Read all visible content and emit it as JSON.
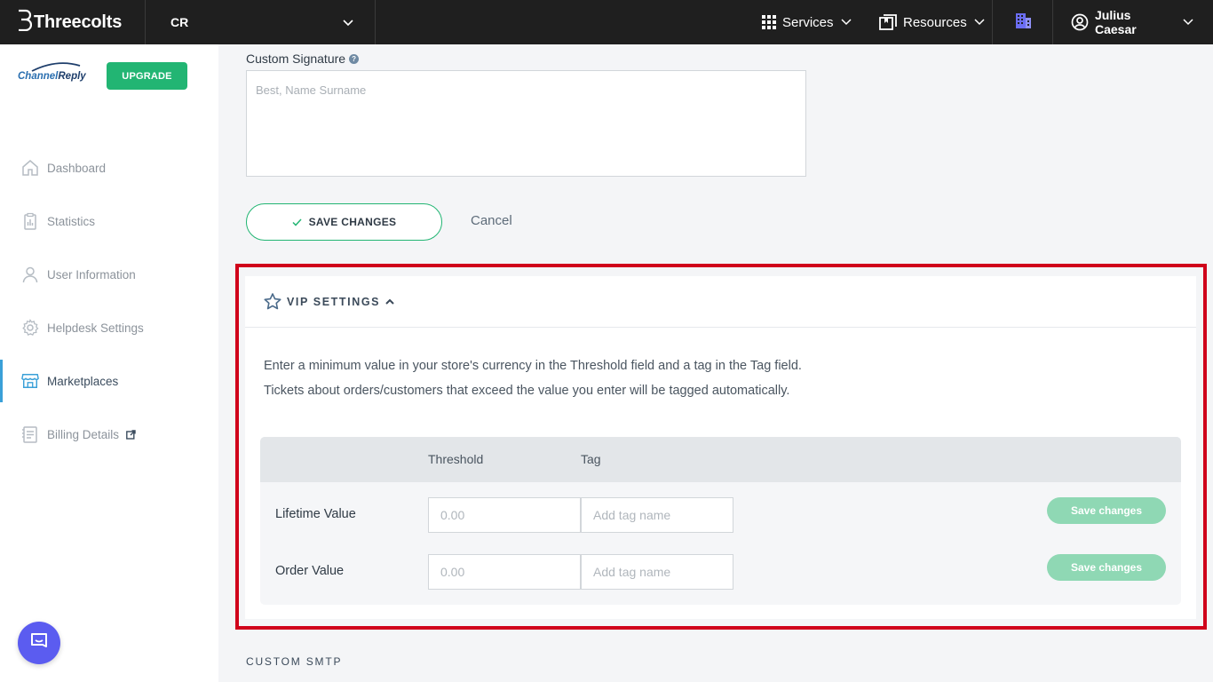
{
  "header": {
    "brand": "Threecolts",
    "account": "CR",
    "services_label": "Services",
    "resources_label": "Resources",
    "user_name": "Julius Caesar"
  },
  "sidebar": {
    "logo_text_a": "Channel",
    "logo_text_b": "Reply",
    "upgrade_label": "UPGRADE",
    "items": [
      {
        "label": "Dashboard",
        "icon": "home-icon"
      },
      {
        "label": "Statistics",
        "icon": "clipboard-chart-icon"
      },
      {
        "label": "User Information",
        "icon": "user-icon"
      },
      {
        "label": "Helpdesk Settings",
        "icon": "gear-icon"
      },
      {
        "label": "Marketplaces",
        "icon": "store-icon",
        "active": true
      },
      {
        "label": "Billing Details",
        "icon": "invoice-icon",
        "external": true
      }
    ]
  },
  "signature": {
    "label": "Custom Signature",
    "placeholder": "Best, Name Surname",
    "save_label": "SAVE CHANGES",
    "cancel_label": "Cancel"
  },
  "vip": {
    "title": "VIP SETTINGS",
    "desc_line1": "Enter a minimum value in your store's currency in the Threshold field and a tag in the Tag field.",
    "desc_line2": "Tickets about orders/customers that exceed the value you enter will be tagged automatically.",
    "col_threshold": "Threshold",
    "col_tag": "Tag",
    "rows": [
      {
        "label": "Lifetime Value",
        "threshold_placeholder": "0.00",
        "tag_placeholder": "Add tag name",
        "save_label": "Save changes"
      },
      {
        "label": "Order Value",
        "threshold_placeholder": "0.00",
        "tag_placeholder": "Add tag name",
        "save_label": "Save changes"
      }
    ]
  },
  "smtp_title": "CUSTOM SMTP",
  "colors": {
    "topbar": "#1f1f1f",
    "accent_green": "#22b573",
    "highlight_red": "#d0021b",
    "chat_purple": "#5b5cf0"
  }
}
